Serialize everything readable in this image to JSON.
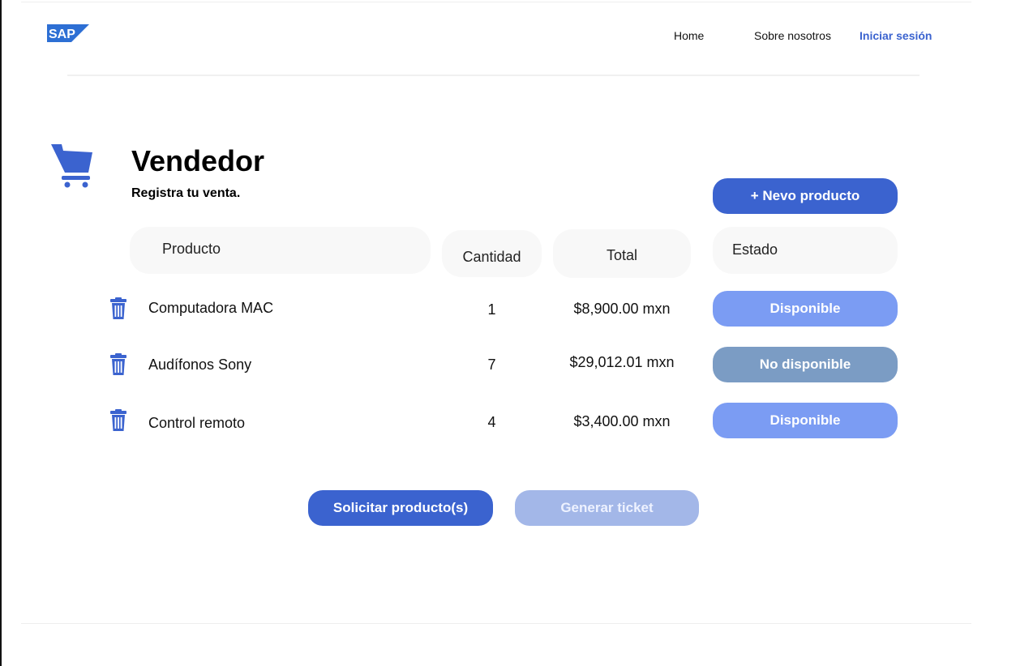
{
  "brand": {
    "logo_text": "SAP",
    "accent": "#3b63cf"
  },
  "nav": {
    "home": "Home",
    "about": "Sobre nosotros",
    "login": "Iniciar sesión"
  },
  "page": {
    "title": "Vendedor",
    "subtitle": "Registra tu venta."
  },
  "icons": {
    "cart": "shopping-cart-icon",
    "delete": "trash-icon"
  },
  "actions": {
    "new_product": "+ Nevo producto",
    "request": "Solicitar producto(s)",
    "ticket": "Generar ticket"
  },
  "table": {
    "headers": {
      "product": "Producto",
      "quantity": "Cantidad",
      "total": "Total",
      "status": "Estado"
    },
    "rows": [
      {
        "product": "Computadora MAC",
        "quantity": "1",
        "total": "$8,900.00 mxn",
        "status": "Disponible",
        "status_color": "#7b9cf3"
      },
      {
        "product": "Audífonos Sony",
        "quantity": "7",
        "total": "$29,012.01 mxn",
        "status": "No disponible",
        "status_color": "#7b9cc4"
      },
      {
        "product": "Control remoto",
        "quantity": "4",
        "total": "$3,400.00 mxn",
        "status": "Disponible",
        "status_color": "#7b9cf3"
      }
    ]
  }
}
